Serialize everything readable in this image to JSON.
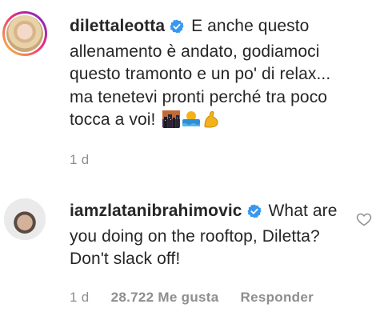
{
  "comments": [
    {
      "username": "dilettaleotta",
      "verified": true,
      "text": "E anche questo allenamento è andato, godiamoci questo tramonto e un po' di relax... ma tenetevi pronti perché tra poco tocca a voi!",
      "emojis": [
        "cityscape-at-dusk-emoji",
        "person-swimming-emoji",
        "flexed-biceps-emoji"
      ],
      "age": "1 d"
    },
    {
      "username": "iamzlatanibrahimovic",
      "verified": true,
      "text": "What are you doing on the rooftop, Diletta? Don't slack off!",
      "age": "1 d",
      "likes": "28.722 Me gusta",
      "reply_label": "Responder"
    }
  ],
  "colors": {
    "verified": "#3897f0",
    "text": "#262626",
    "meta": "#8e8e8e"
  }
}
